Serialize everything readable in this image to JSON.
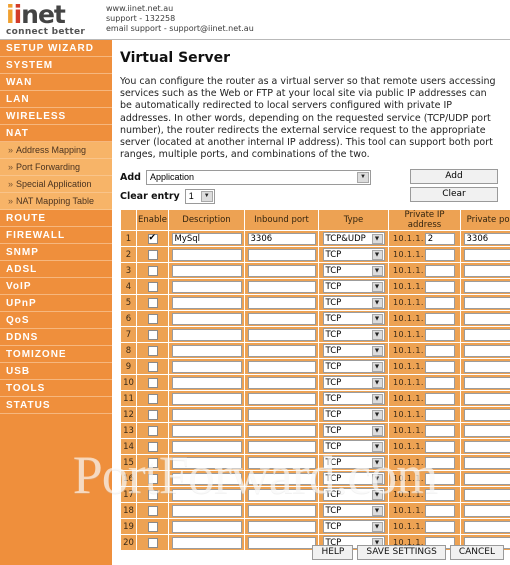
{
  "header": {
    "logo_i1": "i",
    "logo_i2": "i",
    "logo_net": "net",
    "logo_tagline": "connect better",
    "website": "www.iinet.net.au",
    "support_phone": "support - 132258",
    "email_support": "email support - support@iinet.net.au"
  },
  "sidebar": {
    "items": [
      {
        "label": "SETUP WIZARD",
        "type": "main"
      },
      {
        "label": "SYSTEM",
        "type": "main"
      },
      {
        "label": "WAN",
        "type": "main"
      },
      {
        "label": "LAN",
        "type": "main"
      },
      {
        "label": "WIRELESS",
        "type": "main"
      },
      {
        "label": "NAT",
        "type": "main"
      },
      {
        "label": "Address Mapping",
        "type": "sub"
      },
      {
        "label": "Port Forwarding",
        "type": "sub"
      },
      {
        "label": "Special Application",
        "type": "sub"
      },
      {
        "label": "NAT Mapping Table",
        "type": "sub"
      },
      {
        "label": "ROUTE",
        "type": "main"
      },
      {
        "label": "FIREWALL",
        "type": "main"
      },
      {
        "label": "SNMP",
        "type": "main"
      },
      {
        "label": "ADSL",
        "type": "main"
      },
      {
        "label": "VoIP",
        "type": "main"
      },
      {
        "label": "UPnP",
        "type": "main"
      },
      {
        "label": "QoS",
        "type": "main"
      },
      {
        "label": "DDNS",
        "type": "main"
      },
      {
        "label": "TOMIZONE",
        "type": "main"
      },
      {
        "label": "USB",
        "type": "main"
      },
      {
        "label": "TOOLS",
        "type": "main"
      },
      {
        "label": "STATUS",
        "type": "main"
      }
    ]
  },
  "main": {
    "title": "Virtual Server",
    "description": "You can configure the router as a virtual server so that remote users accessing services such as the Web or FTP at your local site via public IP addresses can be automatically redirected to local servers configured with private IP addresses. In other words, depending on the requested service (TCP/UDP port number), the router redirects the external service request to the appropriate server (located at another internal IP address). This tool can support both port ranges, multiple ports, and combinations of the two."
  },
  "controls": {
    "add_label": "Add",
    "add_select_value": "Application",
    "clear_entry_label": "Clear entry",
    "clear_entry_value": "1",
    "add_button": "Add",
    "clear_button": "Clear"
  },
  "table": {
    "columns": [
      "",
      "Enable",
      "Description",
      "Inbound port",
      "Type",
      "Private IP address",
      "Private port"
    ],
    "ip_prefix": "10.1.1.",
    "rows": [
      {
        "index": "1",
        "enabled": true,
        "description": "MySql",
        "inbound_port": "3306",
        "type": "TCP&UDP",
        "private_ip": "2",
        "private_port": "3306"
      },
      {
        "index": "2",
        "enabled": false,
        "description": "",
        "inbound_port": "",
        "type": "TCP",
        "private_ip": "",
        "private_port": ""
      },
      {
        "index": "3",
        "enabled": false,
        "description": "",
        "inbound_port": "",
        "type": "TCP",
        "private_ip": "",
        "private_port": ""
      },
      {
        "index": "4",
        "enabled": false,
        "description": "",
        "inbound_port": "",
        "type": "TCP",
        "private_ip": "",
        "private_port": ""
      },
      {
        "index": "5",
        "enabled": false,
        "description": "",
        "inbound_port": "",
        "type": "TCP",
        "private_ip": "",
        "private_port": ""
      },
      {
        "index": "6",
        "enabled": false,
        "description": "",
        "inbound_port": "",
        "type": "TCP",
        "private_ip": "",
        "private_port": ""
      },
      {
        "index": "7",
        "enabled": false,
        "description": "",
        "inbound_port": "",
        "type": "TCP",
        "private_ip": "",
        "private_port": ""
      },
      {
        "index": "8",
        "enabled": false,
        "description": "",
        "inbound_port": "",
        "type": "TCP",
        "private_ip": "",
        "private_port": ""
      },
      {
        "index": "9",
        "enabled": false,
        "description": "",
        "inbound_port": "",
        "type": "TCP",
        "private_ip": "",
        "private_port": ""
      },
      {
        "index": "10",
        "enabled": false,
        "description": "",
        "inbound_port": "",
        "type": "TCP",
        "private_ip": "",
        "private_port": ""
      },
      {
        "index": "11",
        "enabled": false,
        "description": "",
        "inbound_port": "",
        "type": "TCP",
        "private_ip": "",
        "private_port": ""
      },
      {
        "index": "12",
        "enabled": false,
        "description": "",
        "inbound_port": "",
        "type": "TCP",
        "private_ip": "",
        "private_port": ""
      },
      {
        "index": "13",
        "enabled": false,
        "description": "",
        "inbound_port": "",
        "type": "TCP",
        "private_ip": "",
        "private_port": ""
      },
      {
        "index": "14",
        "enabled": false,
        "description": "",
        "inbound_port": "",
        "type": "TCP",
        "private_ip": "",
        "private_port": ""
      },
      {
        "index": "15",
        "enabled": false,
        "description": "",
        "inbound_port": "",
        "type": "TCP",
        "private_ip": "",
        "private_port": ""
      },
      {
        "index": "16",
        "enabled": false,
        "description": "",
        "inbound_port": "",
        "type": "TCP",
        "private_ip": "",
        "private_port": ""
      },
      {
        "index": "17",
        "enabled": false,
        "description": "",
        "inbound_port": "",
        "type": "TCP",
        "private_ip": "",
        "private_port": ""
      },
      {
        "index": "18",
        "enabled": false,
        "description": "",
        "inbound_port": "",
        "type": "TCP",
        "private_ip": "",
        "private_port": ""
      },
      {
        "index": "19",
        "enabled": false,
        "description": "",
        "inbound_port": "",
        "type": "TCP",
        "private_ip": "",
        "private_port": ""
      },
      {
        "index": "20",
        "enabled": false,
        "description": "",
        "inbound_port": "",
        "type": "TCP",
        "private_ip": "",
        "private_port": ""
      }
    ]
  },
  "footer": {
    "help": "HELP",
    "save": "SAVE SETTINGS",
    "cancel": "CANCEL"
  },
  "watermark": {
    "text": "PortForward.com"
  },
  "colors": {
    "sidebar_orange": "#ef8f3c",
    "submenu_orange": "#f7b468",
    "table_orange": "#eda253"
  }
}
